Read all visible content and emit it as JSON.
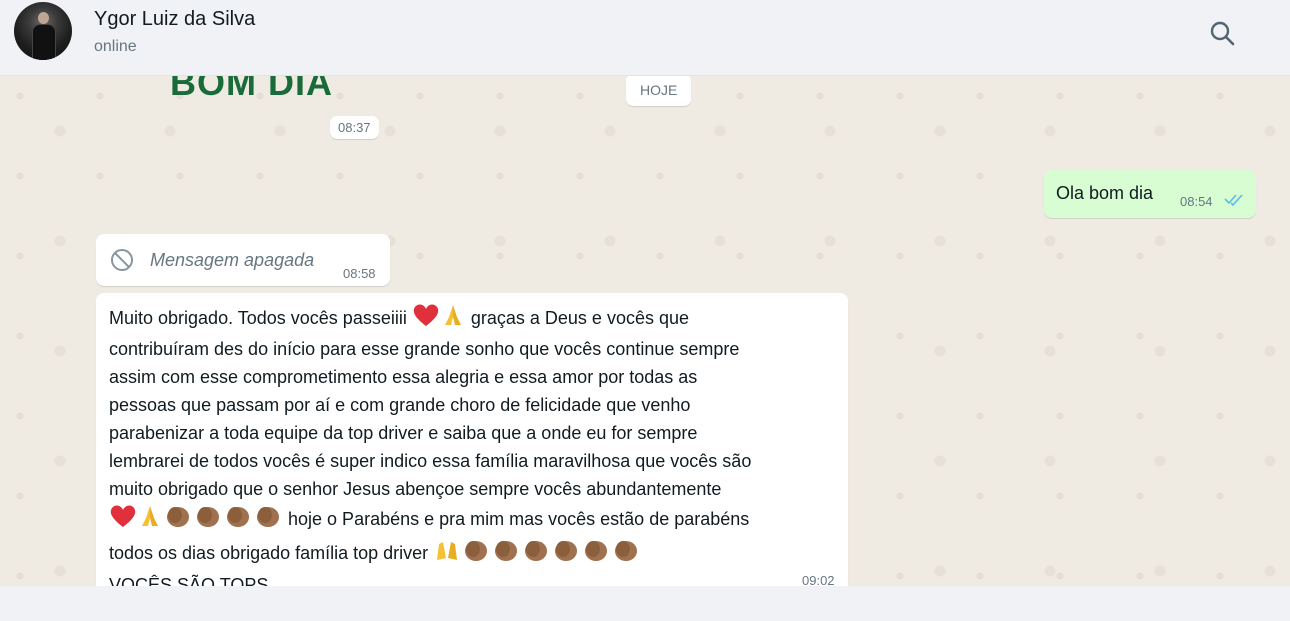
{
  "header": {
    "contact_name": "Ygor Luiz da Silva",
    "status": "online"
  },
  "chat": {
    "banner_text": "BOM DIA",
    "banner_time": "08:37",
    "date_chip": "HOJE",
    "outgoing": {
      "text": "Ola bom dia",
      "time": "08:54",
      "status": "read"
    },
    "deleted": {
      "text": "Mensagem apagada",
      "time": "08:58"
    },
    "long_message": {
      "lines": [
        "Muito obrigado. Todos vocês passeiiii",
        "graças a Deus e vocês que",
        "contribuíram des do início para esse grande sonho que vocês continue sempre",
        "assim com esse comprometimento essa alegria e essa amor por todas as",
        "pessoas que passam por aí e com grande choro de felicidade que venho",
        "parabenizar a toda equipe da top driver e saiba que a onde eu for sempre",
        "lembrarei de todos vocês é super indico essa família maravilhosa que vocês são",
        "muito obrigado que o senhor Jesus abençoe sempre vocês abundantemente",
        "hoje o Parabéns e pra mim mas vocês estão de parabéns",
        "todos os dias obrigado família top driver",
        "VOCÊS SÃO TOPS"
      ],
      "time": "09:02"
    }
  },
  "colors": {
    "chat_bg": "#efeae2",
    "outgoing_bubble": "#d9fdd3",
    "incoming_bubble": "#ffffff",
    "read_ticks": "#53bdeb",
    "banner_green": "#1a6b3a"
  },
  "icons": [
    "search-icon",
    "deleted-icon",
    "double-check-icon",
    "heart-emoji",
    "pray-emoji",
    "clap-emoji",
    "raised-hands-emoji"
  ]
}
